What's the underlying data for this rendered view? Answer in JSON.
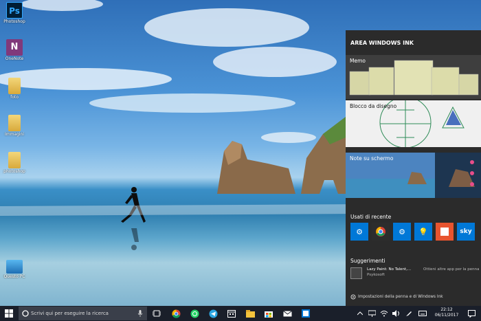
{
  "desktop": {
    "icons": [
      {
        "label": "Photoshop",
        "icon": "photoshop-icon",
        "glyph": "Ps"
      },
      {
        "label": "OneNote",
        "icon": "onenote-icon",
        "glyph": "N"
      },
      {
        "label": "foto",
        "icon": "folder-icon"
      },
      {
        "label": "Immagini",
        "icon": "folder-icon"
      },
      {
        "label": "photoshop",
        "icon": "folder-icon"
      },
      {
        "label": "Questo PC",
        "icon": "computer-icon"
      }
    ]
  },
  "ink_panel": {
    "title": "AREA WINDOWS INK",
    "memo": {
      "label": "Memo"
    },
    "sketchpad": {
      "label": "Blocco da disegno"
    },
    "screen_sketch": {
      "label": "Note su schermo"
    },
    "recent": {
      "label": "Usati di recente",
      "apps": [
        {
          "icon": "gear-icon",
          "color": "#0078d7",
          "glyph": "⚙"
        },
        {
          "icon": "chrome-icon",
          "color": "#2d2d2d",
          "glyph": ""
        },
        {
          "icon": "settings-gear-icon",
          "color": "#0078d7",
          "glyph": "⚙"
        },
        {
          "icon": "lightbulb-icon",
          "color": "#0078d7",
          "glyph": "💡"
        },
        {
          "icon": "sticky-notes-icon",
          "color": "#e8542f",
          "glyph": ""
        },
        {
          "icon": "sky-icon",
          "color": "#0078d7",
          "glyph": "sky"
        }
      ]
    },
    "suggestions": {
      "label": "Suggerimenti",
      "item_name": "Lazy Paint: No Talent,...",
      "item_publisher": "Psykosoft",
      "item_action": "Ottieni altre app per la penna"
    },
    "settings_link": "Impostazioni della penna e di Windows Ink"
  },
  "taskbar": {
    "search_placeholder": "Scrivi qui per eseguire la ricerca",
    "time": "22:12",
    "date": "06/11/2017"
  },
  "colors": {
    "taskbar": "#1a1f2a",
    "panel": "#2b2b2b",
    "accent": "#0078d7"
  }
}
